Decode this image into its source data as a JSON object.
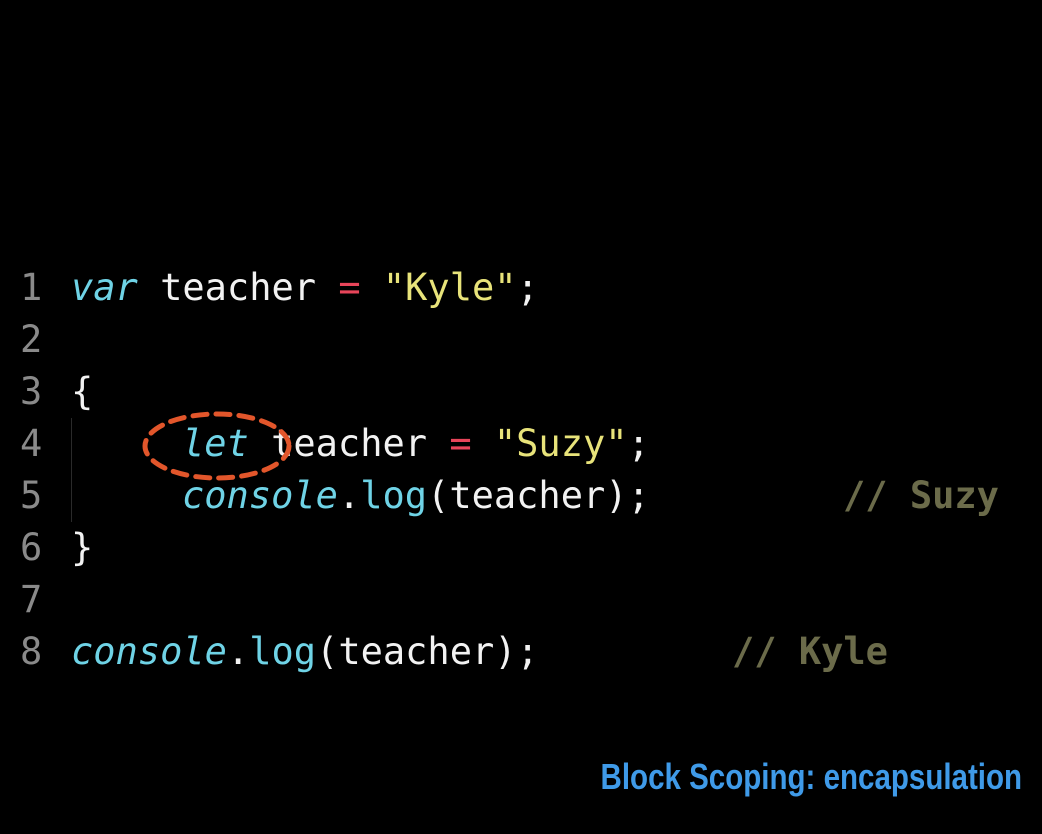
{
  "colors": {
    "background": "#000000",
    "line_number": "#8a8a8a",
    "keyword": "#6fd3e6",
    "identifier": "#f2f2f2",
    "operator": "#e8455a",
    "string": "#e8e37a",
    "method": "#6fd3e6",
    "comment": "#6b6b4a",
    "highlight": "#e2562b",
    "caption": "#3f9ae8"
  },
  "code": {
    "lines": [
      {
        "number": "1",
        "tokens": [
          {
            "text": "var",
            "kind": "keyword"
          },
          {
            "text": " teacher ",
            "kind": "identifier"
          },
          {
            "text": "=",
            "kind": "operator"
          },
          {
            "text": " ",
            "kind": "identifier"
          },
          {
            "text": "\"Kyle\"",
            "kind": "string"
          },
          {
            "text": ";",
            "kind": "identifier"
          }
        ]
      },
      {
        "number": "2",
        "tokens": []
      },
      {
        "number": "3",
        "tokens": [
          {
            "text": "{",
            "kind": "identifier"
          }
        ]
      },
      {
        "number": "4",
        "tokens": [
          {
            "text": "let",
            "kind": "keyword"
          },
          {
            "text": " teacher ",
            "kind": "identifier"
          },
          {
            "text": "=",
            "kind": "operator"
          },
          {
            "text": " ",
            "kind": "identifier"
          },
          {
            "text": "\"Suzy\"",
            "kind": "string"
          },
          {
            "text": ";",
            "kind": "identifier"
          }
        ]
      },
      {
        "number": "5",
        "tokens": [
          {
            "text": "console",
            "kind": "keyword"
          },
          {
            "text": ".",
            "kind": "identifier"
          },
          {
            "text": "log",
            "kind": "method"
          },
          {
            "text": "(teacher);",
            "kind": "identifier"
          },
          {
            "text": "   ",
            "kind": "identifier"
          },
          {
            "text": "// Suzy",
            "kind": "comment"
          }
        ]
      },
      {
        "number": "6",
        "tokens": [
          {
            "text": "}",
            "kind": "identifier"
          }
        ]
      },
      {
        "number": "7",
        "tokens": []
      },
      {
        "number": "8",
        "tokens": [
          {
            "text": "console",
            "kind": "keyword"
          },
          {
            "text": ".",
            "kind": "identifier"
          },
          {
            "text": "log",
            "kind": "method"
          },
          {
            "text": "(teacher);",
            "kind": "identifier"
          },
          {
            "text": "   ",
            "kind": "identifier"
          },
          {
            "text": "// Kyle",
            "kind": "comment"
          }
        ]
      }
    ]
  },
  "caption": {
    "text": "Block Scoping: encapsulation"
  }
}
